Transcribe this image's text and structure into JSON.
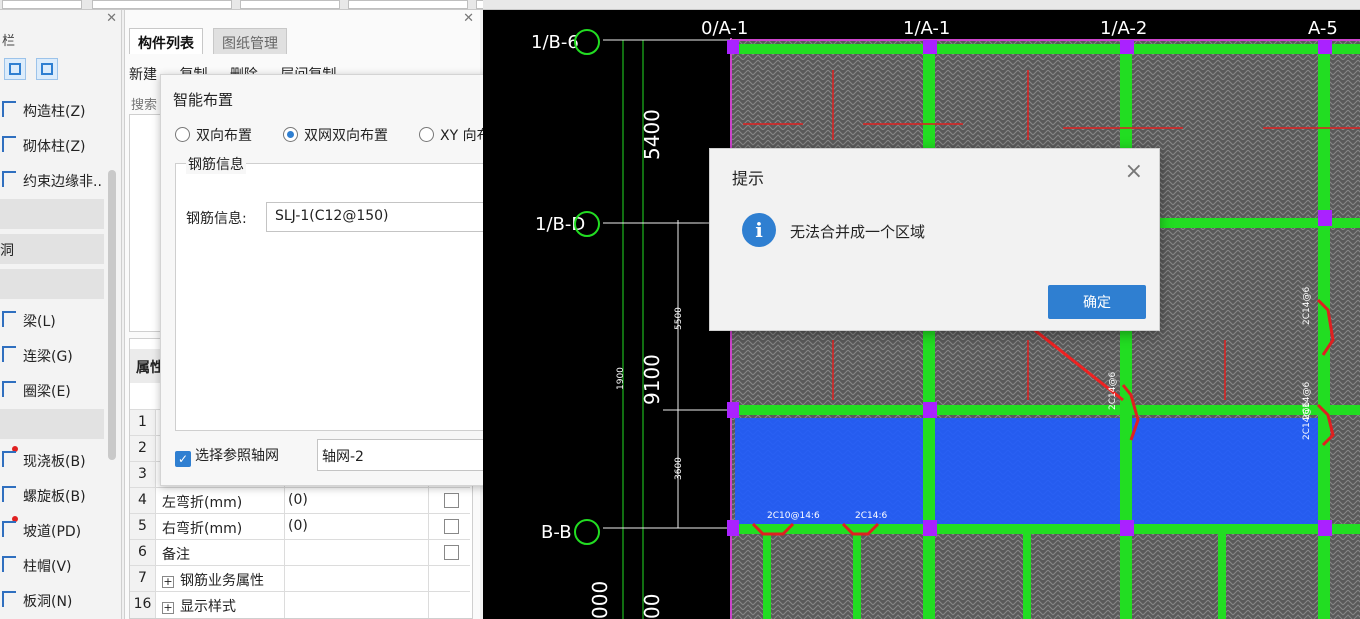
{
  "sidebar": {
    "title": "栏",
    "items": [
      {
        "label": "构造柱(Z)"
      },
      {
        "label": "砌体柱(Z)"
      },
      {
        "label": "约束边缘非.."
      },
      {
        "label": "梁(L)"
      },
      {
        "label": "连梁(G)"
      },
      {
        "label": "圈梁(E)"
      },
      {
        "label": "现浇板(B)"
      },
      {
        "label": "螺旋板(B)"
      },
      {
        "label": "坡道(PD)"
      },
      {
        "label": "柱帽(V)"
      },
      {
        "label": "板洞(N)"
      }
    ],
    "groups": [
      {
        "label": ""
      },
      {
        "label": "洞"
      },
      {
        "label": ""
      },
      {
        "label": ""
      }
    ]
  },
  "component_panel": {
    "tabs": [
      {
        "label": "构件列表"
      },
      {
        "label": "图纸管理"
      }
    ],
    "toolbar": {
      "new": "新建",
      "copy": "复制",
      "delete": "删除",
      "layer_copy": "层间复制"
    },
    "search_placeholder": "搜索",
    "properties": {
      "header": "属性",
      "rows": [
        {
          "num": "1",
          "name": "",
          "value": ""
        },
        {
          "num": "2",
          "name": "",
          "value": ""
        },
        {
          "num": "3",
          "name": "",
          "value": ""
        },
        {
          "num": "4",
          "name": "左弯折(mm)",
          "value": "(0)"
        },
        {
          "num": "5",
          "name": "右弯折(mm)",
          "value": "(0)"
        },
        {
          "num": "6",
          "name": "备注",
          "value": ""
        },
        {
          "num": "7",
          "name": "钢筋业务属性",
          "value": ""
        },
        {
          "num": "16",
          "name": "显示样式",
          "value": ""
        }
      ]
    }
  },
  "smart_layout": {
    "title": "智能布置",
    "options": [
      {
        "label": "双向布置",
        "selected": false
      },
      {
        "label": "双网双向布置",
        "selected": true
      },
      {
        "label": "XY 向布置",
        "selected": false
      }
    ],
    "rebar_group": "钢筋信息",
    "rebar_label": "钢筋信息:",
    "rebar_value": "SLJ-1(C12@150)",
    "ref_grid_label": "选择参照轴网",
    "ref_grid_checked": true,
    "ref_grid_value": "轴网-2"
  },
  "cad": {
    "axis_top": [
      "0/A-1",
      "1/A-1",
      "1/A-2",
      "A-5"
    ],
    "axis_left": [
      "1/B-6",
      "1/B-D",
      "B-B"
    ],
    "dims": [
      "5400",
      "9100",
      "5500",
      "1900",
      "3600",
      "000",
      "00"
    ],
    "rebar_labels": [
      "2C14@6",
      "2C14@6",
      "2C14@6",
      "2C14@6",
      "2C10@14:6",
      "2C14:6"
    ]
  },
  "info_dialog": {
    "title": "提示",
    "message": "无法合并成一个区域",
    "ok": "确定",
    "icon": "i"
  },
  "colors": {
    "accent": "#2f7fd1",
    "cad_bg": "#000000",
    "beam_green": "#22dd22",
    "slab_blue": "#1f5cff",
    "axis_magenta": "#cc44cc",
    "rebar_red": "#e02020"
  }
}
